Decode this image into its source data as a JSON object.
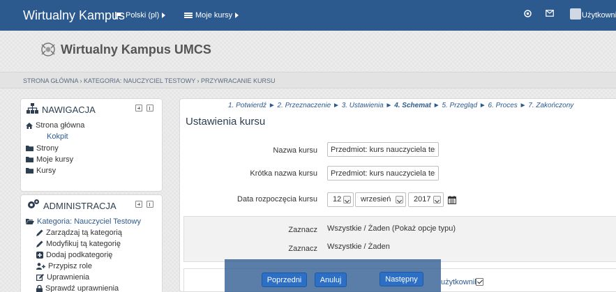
{
  "navbar": {
    "brand": "Wirtualny Kampus",
    "language": "Polski (pl)",
    "my_courses": "Moje kursy",
    "user": "Użytkownik"
  },
  "header": {
    "site_title": "Wirtualny Kampus UMCS"
  },
  "breadcrumb": "STRONA GŁÓWNA › KATEGORIA: NAUCZYCIEL TESTOWY › PRZYWRACANIE KURSU",
  "nav_block": {
    "title": "NAWIGACJA",
    "items": [
      {
        "label": "Strona główna",
        "icon": "home-icon"
      },
      {
        "label": "Kokpit"
      },
      {
        "label": "Strony",
        "icon": "folder-icon"
      },
      {
        "label": "Moje kursy",
        "icon": "folder-icon"
      },
      {
        "label": "Kursy",
        "icon": "folder-icon"
      }
    ]
  },
  "admin_block": {
    "title": "ADMINISTRACJA",
    "items": [
      {
        "label": "Kategoria: Nauczyciel Testowy",
        "icon": "folder-open-icon"
      },
      {
        "label": "Zarządzaj tą kategorią",
        "icon": "pencil-icon"
      },
      {
        "label": "Modyfikuj tą kategorię",
        "icon": "pencil-icon"
      },
      {
        "label": "Dodaj podkategorię",
        "icon": "plus-square-icon"
      },
      {
        "label": "Przypisz role",
        "icon": "user-plus-icon"
      },
      {
        "label": "Uprawnienia",
        "icon": "edit-icon"
      },
      {
        "label": "Sprawdź uprawnienia",
        "icon": "lock-icon"
      }
    ]
  },
  "wizard": {
    "steps": [
      "1. Potwierdź",
      "2. Przeznaczenie",
      "3. Ustawienia",
      "4. Schemat",
      "5. Przegląd",
      "6. Proces",
      "7. Zakończony"
    ],
    "current_step": "4. Schemat",
    "separator": "►"
  },
  "main": {
    "title": "Ustawienia kursu",
    "course_name_label": "Nazwa kursu",
    "course_name_value": "Przedmiot: kurs nauczyciela testc",
    "short_name_label": "Krótka nazwa kursu",
    "short_name_value": "Przedmiot: kurs nauczyciela testc",
    "start_date_label": "Data rozpoczęcia kursu",
    "start_day": "12",
    "start_month": "wrzesień",
    "start_year": "2017",
    "select1_label": "Zaznacz",
    "select1_value": "Wszystkie / Żaden (Pokaż opcje typu)",
    "select2_label": "Zaznacz",
    "select2_value": "Wszystkie / Żaden",
    "users_label": "użytkownika"
  },
  "buttons": {
    "previous": "Poprzedni",
    "cancel": "Anuluj",
    "next": "Następny"
  },
  "colors": {
    "navbar": "#2c5a8f",
    "button": "#2c6fc4"
  }
}
